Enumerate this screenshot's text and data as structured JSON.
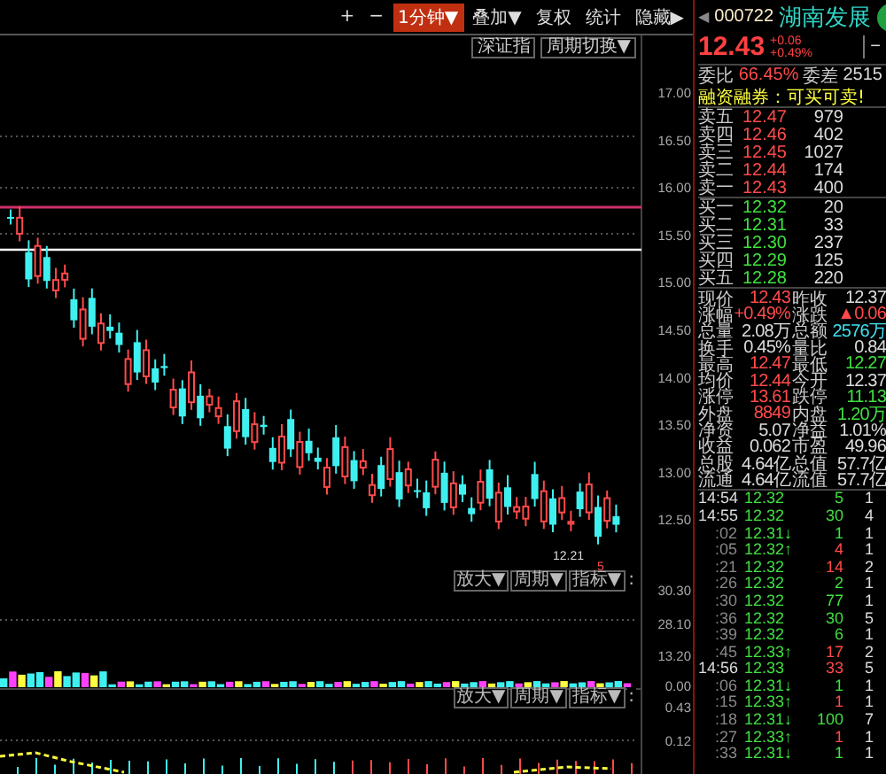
{
  "toolbar": [
    {
      "label": "+",
      "selected": false
    },
    {
      "label": "−",
      "selected": false
    },
    {
      "label": "1分钟▼",
      "selected": true
    },
    {
      "label": "叠加▼",
      "selected": false
    },
    {
      "label": "复权",
      "selected": false
    },
    {
      "label": "统计",
      "selected": false
    },
    {
      "label": "隐藏▶",
      "selected": false
    }
  ],
  "sub_toolbar": [
    "深证指",
    "周期切换▼"
  ],
  "chart": {
    "price_axis": [
      "17.00",
      "16.50",
      "16.00",
      "15.50",
      "15.00",
      "14.50",
      "14.00",
      "13.50",
      "13.00",
      "12.50"
    ],
    "lower_axis": [
      "30.30",
      "28.10",
      "13.20",
      "0.00",
      "0.43",
      "0.12"
    ],
    "low_label": "12.21",
    "marker_label": "5",
    "panel_buttons": [
      [
        "放大▼",
        "周期▼",
        "指标▼",
        ":"
      ],
      [
        "放大▼",
        "周期▼",
        "指标▼",
        ":"
      ]
    ]
  },
  "quote": {
    "back": "◀",
    "code": "000722",
    "name": "湖南发展",
    "price": "12.43",
    "change": "+0.06",
    "percent": "+0.49%",
    "minimize": "−"
  },
  "ratio": {
    "label": "委比",
    "value": "66.45%",
    "label2": "委差",
    "value2": "2515"
  },
  "notice": "融资融券：可买可卖!",
  "asks": [
    {
      "label": "卖五",
      "price": "12.47",
      "volume": "979",
      "color": "#ff4a4a"
    },
    {
      "label": "卖四",
      "price": "12.46",
      "volume": "402",
      "color": "#ff4a4a"
    },
    {
      "label": "卖三",
      "price": "12.45",
      "volume": "1027",
      "color": "#ff4a4a"
    },
    {
      "label": "卖二",
      "price": "12.44",
      "volume": "174",
      "color": "#ff4a4a"
    },
    {
      "label": "卖一",
      "price": "12.43",
      "volume": "400",
      "color": "#ff4a4a"
    }
  ],
  "bids": [
    {
      "label": "买一",
      "price": "12.32",
      "volume": "20",
      "color": "#40e040"
    },
    {
      "label": "买二",
      "price": "12.31",
      "volume": "33",
      "color": "#40e040"
    },
    {
      "label": "买三",
      "price": "12.30",
      "volume": "237",
      "color": "#40e040"
    },
    {
      "label": "买四",
      "price": "12.29",
      "volume": "125",
      "color": "#40e040"
    },
    {
      "label": "买五",
      "price": "12.28",
      "volume": "220",
      "color": "#40e040"
    }
  ],
  "stats": [
    [
      {
        "label": "现价",
        "value": "12.43",
        "color": "#ff4a4a"
      },
      {
        "label": "昨收",
        "value": "12.37",
        "color": "#dddddd"
      }
    ],
    [
      {
        "label": "涨幅",
        "value": "+0.49%",
        "color": "#ff4a4a"
      },
      {
        "label": "涨跌",
        "value": "▲0.06",
        "color": "#ff4a4a"
      }
    ],
    [
      {
        "label": "总量",
        "value": "2.08万",
        "color": "#dddddd"
      },
      {
        "label": "总额",
        "value": "2576万",
        "color": "#40e0f0"
      }
    ],
    [
      {
        "label": "换手",
        "value": "0.45%",
        "color": "#dddddd"
      },
      {
        "label": "量比",
        "value": "0.84",
        "color": "#dddddd"
      }
    ],
    [
      {
        "label": "最高",
        "value": "12.47",
        "color": "#ff4a4a"
      },
      {
        "label": "最低",
        "value": "12.27",
        "color": "#40e040"
      }
    ],
    [
      {
        "label": "均价",
        "value": "12.44",
        "color": "#ff4a4a"
      },
      {
        "label": "今开",
        "value": "12.37",
        "color": "#dddddd"
      }
    ],
    [
      {
        "label": "涨停",
        "value": "13.61",
        "color": "#ff4a4a"
      },
      {
        "label": "跌停",
        "value": "11.13",
        "color": "#40e040"
      }
    ],
    [
      {
        "label": "外盘",
        "value": "8849",
        "color": "#ff4a4a"
      },
      {
        "label": "内盘",
        "value": "1.20万",
        "color": "#40e040"
      }
    ],
    [
      {
        "label": "净资",
        "value": "5.07",
        "color": "#dddddd"
      },
      {
        "label": "净益",
        "value": "1.01%",
        "color": "#dddddd"
      }
    ],
    [
      {
        "label": "收益",
        "value": "0.062",
        "color": "#dddddd"
      },
      {
        "label": "市盈",
        "value": "49.96",
        "color": "#dddddd"
      }
    ],
    [
      {
        "label": "总股",
        "value": "4.64亿",
        "color": "#dddddd"
      },
      {
        "label": "总值",
        "value": "57.7亿",
        "color": "#dddddd"
      }
    ],
    [
      {
        "label": "流通",
        "value": "4.64亿",
        "color": "#dddddd"
      },
      {
        "label": "流值",
        "value": "57.7亿",
        "color": "#dddddd"
      }
    ]
  ],
  "trades": [
    {
      "time": "14:54",
      "price": "12.32",
      "volume": "5",
      "color": "#40e040",
      "count": "1"
    },
    {
      "time": "14:55",
      "price": "12.32",
      "volume": "30",
      "color": "#40e040",
      "count": "4"
    },
    {
      "time": ":02",
      "price": "12.31",
      "arrow": "↓",
      "volume": "1",
      "color": "#40e040",
      "count": "1"
    },
    {
      "time": ":05",
      "price": "12.32",
      "arrow": "↑",
      "volume": "4",
      "color": "#ff4a4a",
      "count": "1"
    },
    {
      "time": ":21",
      "price": "12.32",
      "volume": "14",
      "color": "#ff4a4a",
      "count": "2"
    },
    {
      "time": ":26",
      "price": "12.32",
      "volume": "2",
      "color": "#40e040",
      "count": "1"
    },
    {
      "time": ":30",
      "price": "12.32",
      "volume": "77",
      "color": "#40e040",
      "count": "1"
    },
    {
      "time": ":36",
      "price": "12.32",
      "volume": "30",
      "color": "#40e040",
      "count": "5"
    },
    {
      "time": ":39",
      "price": "12.32",
      "volume": "6",
      "color": "#40e040",
      "count": "1"
    },
    {
      "time": ":45",
      "price": "12.33",
      "arrow": "↑",
      "volume": "17",
      "color": "#ff4a4a",
      "count": "2"
    },
    {
      "time": "14:56",
      "price": "12.33",
      "volume": "33",
      "color": "#ff4a4a",
      "count": "5"
    },
    {
      "time": ":06",
      "price": "12.31",
      "arrow": "↓",
      "volume": "1",
      "color": "#40e040",
      "count": "1"
    },
    {
      "time": ":15",
      "price": "12.33",
      "arrow": "↑",
      "volume": "1",
      "color": "#ff4a4a",
      "count": "1"
    },
    {
      "time": ":18",
      "price": "12.31",
      "arrow": "↓",
      "volume": "100",
      "color": "#40e040",
      "count": "7"
    },
    {
      "time": ":27",
      "price": "12.33",
      "arrow": "↑",
      "volume": "1",
      "color": "#ff4a4a",
      "count": "1"
    },
    {
      "time": ":33",
      "price": "12.31",
      "arrow": "↓",
      "volume": "1",
      "color": "#40e040",
      "count": "1"
    }
  ]
}
